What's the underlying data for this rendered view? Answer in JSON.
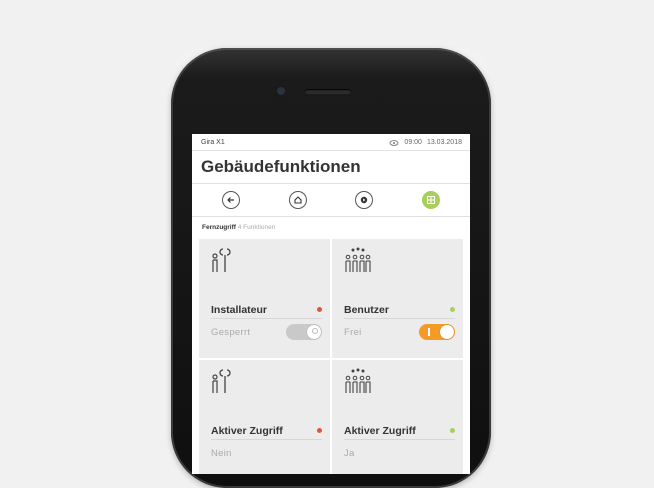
{
  "device": {
    "name": "iPhone"
  },
  "status": {
    "app_name": "Gira X1",
    "time": "09:00",
    "date": "13.03.2018",
    "cloud_icon": "cloud-icon"
  },
  "header": {
    "title": "Gebäudefunktionen"
  },
  "nav": {
    "back": "back-arrow-icon",
    "home": "home-icon",
    "play": "play-icon",
    "grid": "grid-icon"
  },
  "section": {
    "title": "Fernzugriff",
    "subtitle": "4 Funktionen"
  },
  "tiles": [
    {
      "label": "Installateur",
      "state": "Gesperrt",
      "dot_color": "#e2533a",
      "toggle": "off",
      "icon": "installer-icon"
    },
    {
      "label": "Benutzer",
      "state": "Frei",
      "dot_color": "#a8cf5d",
      "toggle": "on",
      "icon": "users-icon"
    },
    {
      "label": "Aktiver Zugriff",
      "state": "Nein",
      "dot_color": "#e2533a",
      "icon": "installer-icon"
    },
    {
      "label": "Aktiver Zugriff",
      "state": "Ja",
      "dot_color": "#a8cf5d",
      "icon": "users-icon"
    }
  ],
  "colors": {
    "accent_green": "#a8cf5d",
    "accent_orange": "#f39a27",
    "alert_red": "#e2533a"
  }
}
